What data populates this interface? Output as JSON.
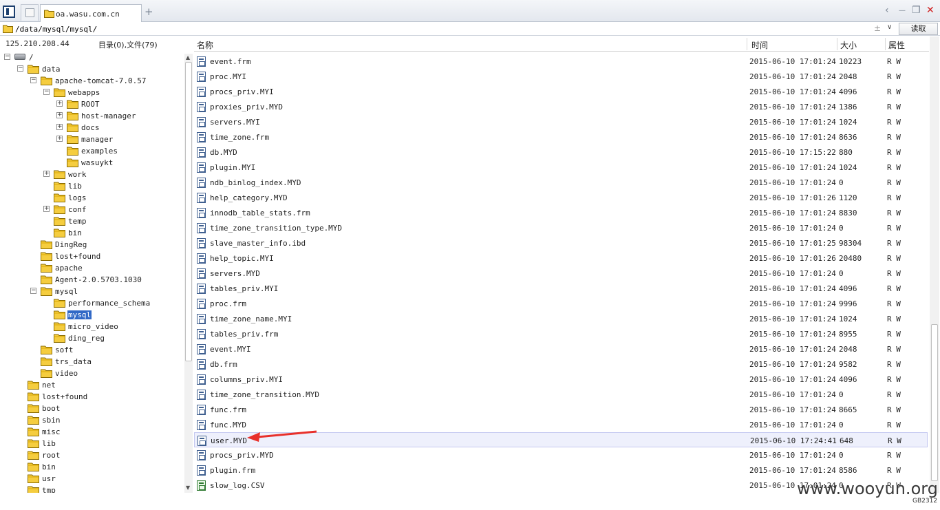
{
  "tabs": {
    "active_label": "oa.wasu.com.cn",
    "new_tab": "+"
  },
  "window_controls": {
    "back": "‹",
    "minimize": "—",
    "restore": "❐",
    "close": "✕"
  },
  "address_bar": {
    "path": "/data/mysql/mysql/",
    "expand": "±",
    "dropdown": "∨",
    "read_label": "读取"
  },
  "left_info": {
    "ip": "125.210.208.44",
    "counts": "目录(0),文件(79)"
  },
  "tree": [
    {
      "label": "/",
      "level": 0,
      "expander": "−",
      "icon": "drive"
    },
    {
      "label": "data",
      "level": 1,
      "expander": "−"
    },
    {
      "label": "apache-tomcat-7.0.57",
      "level": 2,
      "expander": "−"
    },
    {
      "label": "webapps",
      "level": 3,
      "expander": "−"
    },
    {
      "label": "ROOT",
      "level": 4,
      "expander": "+"
    },
    {
      "label": "host-manager",
      "level": 4,
      "expander": "+"
    },
    {
      "label": "docs",
      "level": 4,
      "expander": "+"
    },
    {
      "label": "manager",
      "level": 4,
      "expander": "+"
    },
    {
      "label": "examples",
      "level": 4,
      "expander": ""
    },
    {
      "label": "wasuykt",
      "level": 4,
      "expander": ""
    },
    {
      "label": "work",
      "level": 3,
      "expander": "+"
    },
    {
      "label": "lib",
      "level": 3,
      "expander": ""
    },
    {
      "label": "logs",
      "level": 3,
      "expander": ""
    },
    {
      "label": "conf",
      "level": 3,
      "expander": "+"
    },
    {
      "label": "temp",
      "level": 3,
      "expander": ""
    },
    {
      "label": "bin",
      "level": 3,
      "expander": ""
    },
    {
      "label": "DingReg",
      "level": 2,
      "expander": ""
    },
    {
      "label": "lost+found",
      "level": 2,
      "expander": ""
    },
    {
      "label": "apache",
      "level": 2,
      "expander": ""
    },
    {
      "label": "Agent-2.0.5703.1030",
      "level": 2,
      "expander": ""
    },
    {
      "label": "mysql",
      "level": 2,
      "expander": "−"
    },
    {
      "label": "performance_schema",
      "level": 3,
      "expander": ""
    },
    {
      "label": "mysql",
      "level": 3,
      "expander": "",
      "selected": true
    },
    {
      "label": "micro_video",
      "level": 3,
      "expander": ""
    },
    {
      "label": "ding_reg",
      "level": 3,
      "expander": ""
    },
    {
      "label": "soft",
      "level": 2,
      "expander": ""
    },
    {
      "label": "trs_data",
      "level": 2,
      "expander": ""
    },
    {
      "label": "video",
      "level": 2,
      "expander": ""
    },
    {
      "label": "net",
      "level": 1,
      "expander": ""
    },
    {
      "label": "lost+found",
      "level": 1,
      "expander": ""
    },
    {
      "label": "boot",
      "level": 1,
      "expander": ""
    },
    {
      "label": "sbin",
      "level": 1,
      "expander": ""
    },
    {
      "label": "misc",
      "level": 1,
      "expander": ""
    },
    {
      "label": "lib",
      "level": 1,
      "expander": ""
    },
    {
      "label": "root",
      "level": 1,
      "expander": ""
    },
    {
      "label": "bin",
      "level": 1,
      "expander": ""
    },
    {
      "label": "usr",
      "level": 1,
      "expander": ""
    },
    {
      "label": "tmp",
      "level": 1,
      "expander": ""
    }
  ],
  "columns": {
    "name": "名称",
    "time": "时间",
    "size": "大小",
    "attr": "属性"
  },
  "files": [
    {
      "name": "event.frm",
      "time": "2015-06-10 17:01:24",
      "size": "10223",
      "attr": "R W"
    },
    {
      "name": "proc.MYI",
      "time": "2015-06-10 17:01:24",
      "size": "2048",
      "attr": "R W"
    },
    {
      "name": "procs_priv.MYI",
      "time": "2015-06-10 17:01:24",
      "size": "4096",
      "attr": "R W"
    },
    {
      "name": "proxies_priv.MYD",
      "time": "2015-06-10 17:01:24",
      "size": "1386",
      "attr": "R W"
    },
    {
      "name": "servers.MYI",
      "time": "2015-06-10 17:01:24",
      "size": "1024",
      "attr": "R W"
    },
    {
      "name": "time_zone.frm",
      "time": "2015-06-10 17:01:24",
      "size": "8636",
      "attr": "R W"
    },
    {
      "name": "db.MYD",
      "time": "2015-06-10 17:15:22",
      "size": "880",
      "attr": "R W"
    },
    {
      "name": "plugin.MYI",
      "time": "2015-06-10 17:01:24",
      "size": "1024",
      "attr": "R W"
    },
    {
      "name": "ndb_binlog_index.MYD",
      "time": "2015-06-10 17:01:24",
      "size": "0",
      "attr": "R W"
    },
    {
      "name": "help_category.MYD",
      "time": "2015-06-10 17:01:26",
      "size": "1120",
      "attr": "R W"
    },
    {
      "name": "innodb_table_stats.frm",
      "time": "2015-06-10 17:01:24",
      "size": "8830",
      "attr": "R W"
    },
    {
      "name": "time_zone_transition_type.MYD",
      "time": "2015-06-10 17:01:24",
      "size": "0",
      "attr": "R W"
    },
    {
      "name": "slave_master_info.ibd",
      "time": "2015-06-10 17:01:25",
      "size": "98304",
      "attr": "R W"
    },
    {
      "name": "help_topic.MYI",
      "time": "2015-06-10 17:01:26",
      "size": "20480",
      "attr": "R W"
    },
    {
      "name": "servers.MYD",
      "time": "2015-06-10 17:01:24",
      "size": "0",
      "attr": "R W"
    },
    {
      "name": "tables_priv.MYI",
      "time": "2015-06-10 17:01:24",
      "size": "4096",
      "attr": "R W"
    },
    {
      "name": "proc.frm",
      "time": "2015-06-10 17:01:24",
      "size": "9996",
      "attr": "R W"
    },
    {
      "name": "time_zone_name.MYI",
      "time": "2015-06-10 17:01:24",
      "size": "1024",
      "attr": "R W"
    },
    {
      "name": "tables_priv.frm",
      "time": "2015-06-10 17:01:24",
      "size": "8955",
      "attr": "R W"
    },
    {
      "name": "event.MYI",
      "time": "2015-06-10 17:01:24",
      "size": "2048",
      "attr": "R W"
    },
    {
      "name": "db.frm",
      "time": "2015-06-10 17:01:24",
      "size": "9582",
      "attr": "R W"
    },
    {
      "name": "columns_priv.MYI",
      "time": "2015-06-10 17:01:24",
      "size": "4096",
      "attr": "R W"
    },
    {
      "name": "time_zone_transition.MYD",
      "time": "2015-06-10 17:01:24",
      "size": "0",
      "attr": "R W"
    },
    {
      "name": "func.frm",
      "time": "2015-06-10 17:01:24",
      "size": "8665",
      "attr": "R W"
    },
    {
      "name": "func.MYD",
      "time": "2015-06-10 17:01:24",
      "size": "0",
      "attr": "R W"
    },
    {
      "name": "user.MYD",
      "time": "2015-06-10 17:24:41",
      "size": "648",
      "attr": "R W",
      "highlighted": true
    },
    {
      "name": "procs_priv.MYD",
      "time": "2015-06-10 17:01:24",
      "size": "0",
      "attr": "R W"
    },
    {
      "name": "plugin.frm",
      "time": "2015-06-10 17:01:24",
      "size": "8586",
      "attr": "R W"
    },
    {
      "name": "slow_log.CSV",
      "time": "2015-06-10 17:01:24",
      "size": "0",
      "attr": "R W",
      "icon": "csv"
    }
  ],
  "watermark": "www.wooyun.org",
  "encoding": "GB2312",
  "colors": {
    "selection": "#3169c6",
    "highlight_row": "#eef0fc",
    "annotation_arrow": "#e8302b"
  }
}
